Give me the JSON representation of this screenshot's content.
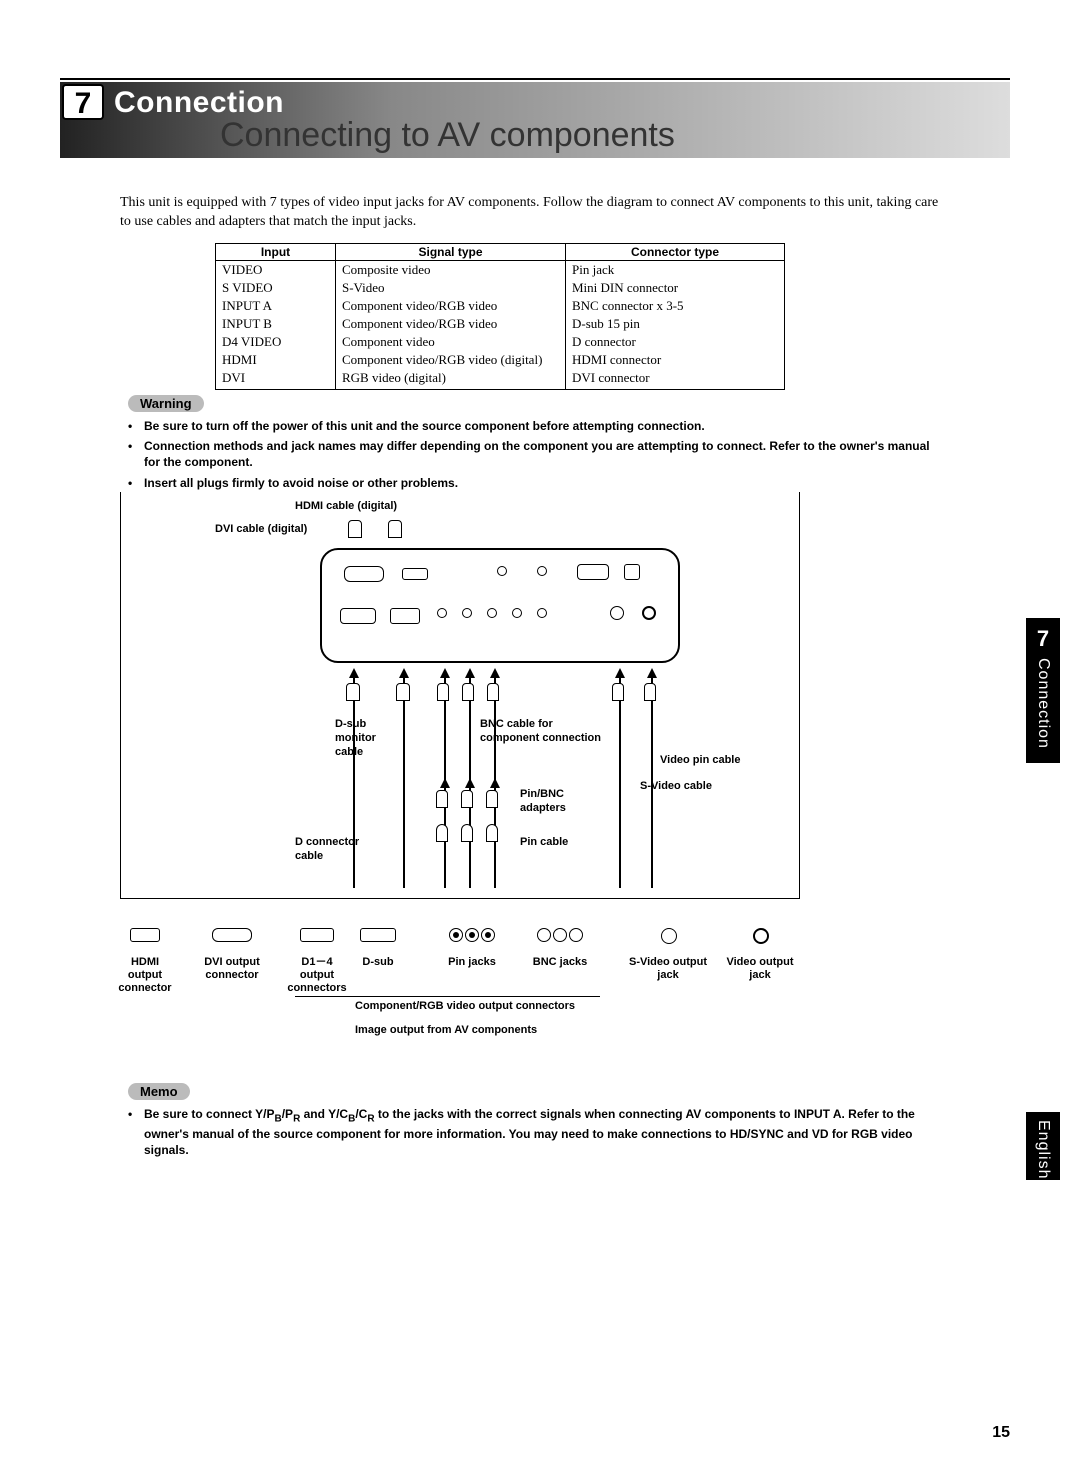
{
  "header": {
    "chapter_number": "7",
    "chapter_title": "Connection",
    "subtitle": "Connecting to AV components"
  },
  "intro_text": "This unit is equipped with 7 types of video input jacks for AV components. Follow the diagram to connect AV components to this unit, taking care to use cables and adapters that match the input jacks.",
  "table": {
    "headers": {
      "c1": "Input",
      "c2": "Signal type",
      "c3": "Connector type"
    },
    "rows": [
      {
        "c1": "VIDEO",
        "c2": "Composite video",
        "c3": "Pin jack"
      },
      {
        "c1": "S VIDEO",
        "c2": "S-Video",
        "c3": "Mini DIN connector"
      },
      {
        "c1": "INPUT A",
        "c2": "Component video/RGB video",
        "c3": "BNC connector x 3-5"
      },
      {
        "c1": "INPUT B",
        "c2": "Component video/RGB video",
        "c3": "D-sub 15 pin"
      },
      {
        "c1": "D4 VIDEO",
        "c2": "Component video",
        "c3": "D connector"
      },
      {
        "c1": "HDMI",
        "c2": "Component video/RGB video (digital)",
        "c3": "HDMI connector"
      },
      {
        "c1": "DVI",
        "c2": "RGB video (digital)",
        "c3": "DVI connector"
      }
    ]
  },
  "warning": {
    "label": "Warning",
    "items": [
      "Be sure to turn off the power of this unit and the source component before attempting connection.",
      "Connection methods and jack names may differ depending on the component you are attempting to connect. Refer to the owner's manual for the component.",
      "Insert all plugs firmly to avoid noise or other problems."
    ]
  },
  "diagram_labels": {
    "hdmi_cable": "HDMI cable (digital)",
    "dvi_cable": "DVI cable (digital)",
    "dsub_monitor": "D-sub\nmonitor\ncable",
    "bnc_cable": "BNC cable for\ncomponent connection",
    "video_pin_cable": "Video pin cable",
    "svideo_cable": "S-Video cable",
    "pin_bnc_adapters": "Pin/BNC\nadapters",
    "pin_cable": "Pin cable",
    "d_connector_cable": "D connector\ncable"
  },
  "connectors_row": {
    "hdmi": "HDMI\noutput\nconnector",
    "dvi": "DVI output\nconnector",
    "d14": "D1－4\noutput\nconnectors",
    "dsub": "D-sub",
    "pin": "Pin jacks",
    "bnc": "BNC jacks",
    "svideo": "S-Video output\njack",
    "video": "Video output\njack",
    "group1": "Component/RGB video output connectors",
    "group2": "Image output from AV components"
  },
  "memo": {
    "label": "Memo",
    "text_parts": {
      "a": "Be sure to connect Y/P",
      "b": "B",
      "c": "/P",
      "d": "R",
      "e": " and Y/C",
      "f": "B",
      "g": "/C",
      "h": "R",
      "i": " to the jacks with the correct signals when connecting AV components to INPUT A. Refer to the owner's manual of the source component for more information. You may need to make connections to HD/SYNC and VD for RGB video signals."
    }
  },
  "side_tabs": {
    "connection": {
      "num": "7",
      "label": "Connection"
    },
    "english": {
      "label": "English"
    }
  },
  "page_number": "15"
}
